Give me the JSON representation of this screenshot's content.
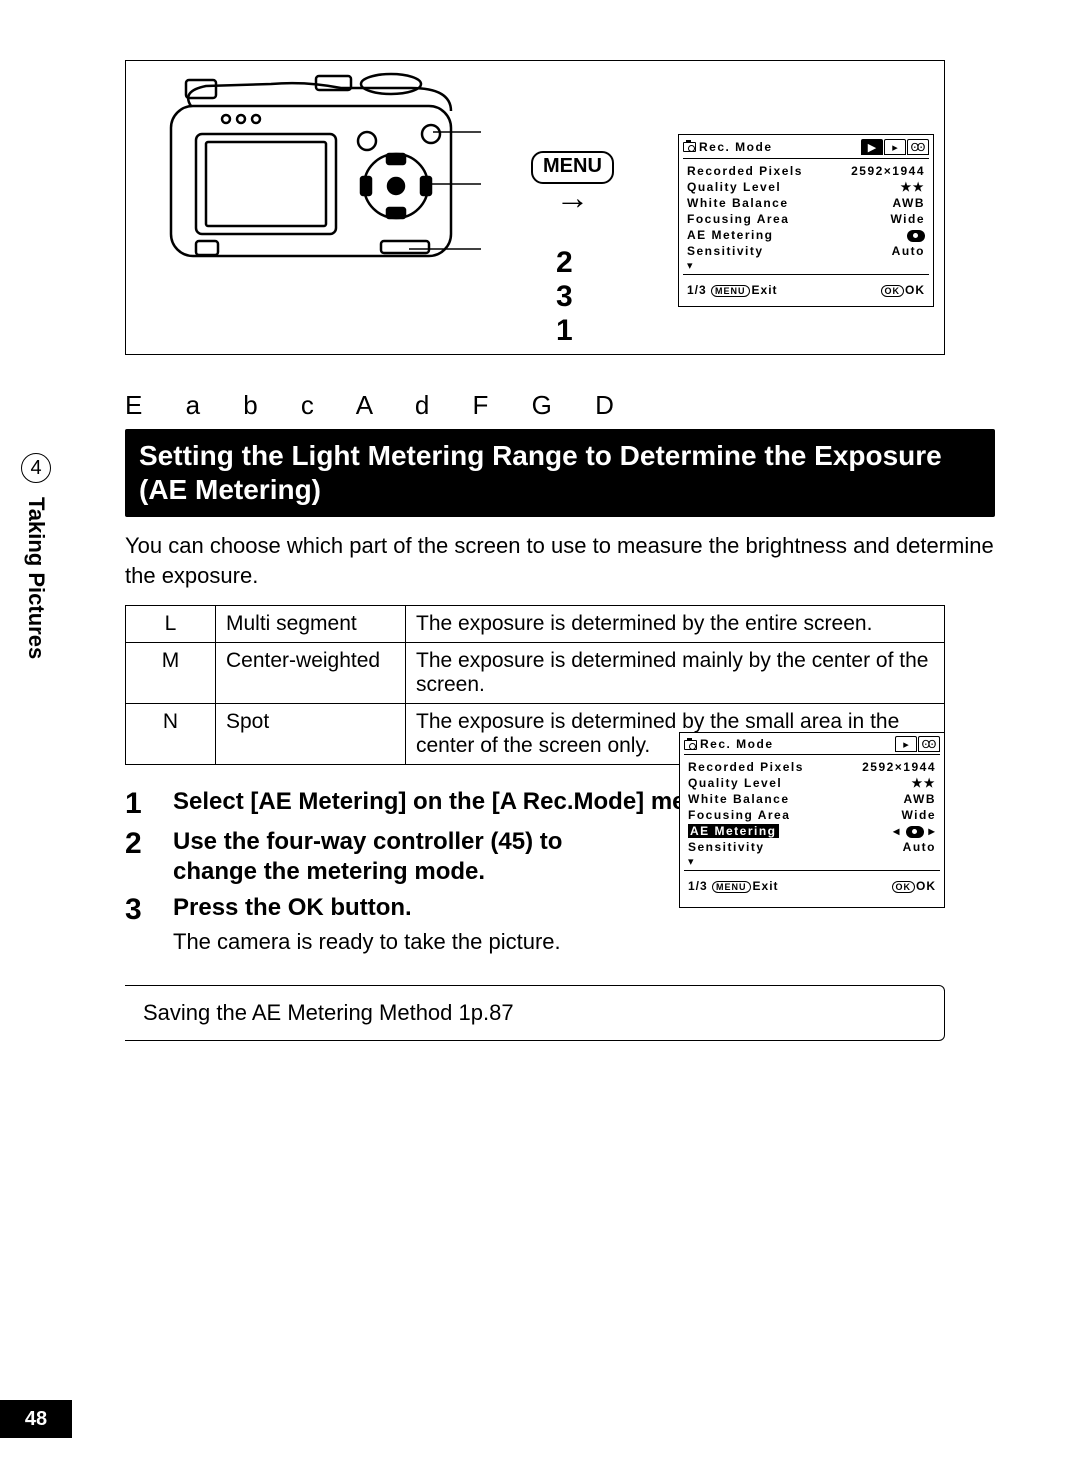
{
  "sidebar": {
    "chapter": "4",
    "label": "Taking Pictures"
  },
  "page_number": "48",
  "diagram": {
    "menu_label": "MENU",
    "step_labels": [
      "2",
      "3",
      "1"
    ]
  },
  "lcd1": {
    "title": "Rec. Mode",
    "rows": [
      {
        "label": "Recorded Pixels",
        "value": "2592×1944"
      },
      {
        "label": "Quality Level",
        "value": "★★"
      },
      {
        "label": "White Balance",
        "value": "AWB"
      },
      {
        "label": "Focusing Area",
        "value": "Wide"
      },
      {
        "label": "AE Metering",
        "value": "meter-icon"
      },
      {
        "label": "Sensitivity",
        "value": "Auto"
      }
    ],
    "footer_left": "1/3",
    "footer_menu": "MENU",
    "footer_exit": "Exit",
    "footer_ok": "OK",
    "footer_ok2": "OK"
  },
  "mode_icons": "E    a  b   c   A  d     F    G  D",
  "title": "Setting the Light Metering Range to Determine the Exposure (AE Metering)",
  "intro": "You can choose which part of the screen to use to measure the brightness and determine the exposure.",
  "table": [
    {
      "icon": "L",
      "name": "Multi segment",
      "desc": "The exposure is determined by the entire screen."
    },
    {
      "icon": "M",
      "name": "Center-weighted",
      "desc": "The exposure is determined mainly by the center of the screen."
    },
    {
      "icon": "N",
      "name": "Spot",
      "desc": "The exposure is determined by the small area in the center of the screen only."
    }
  ],
  "steps": [
    {
      "n": "1",
      "head": "Select [AE Metering] on the [A Rec.Mode] menu."
    },
    {
      "n": "2",
      "head": "Use the four-way controller (45) to change the metering mode."
    },
    {
      "n": "3",
      "head": "Press the OK button.",
      "sub": "The camera is ready to take the picture."
    }
  ],
  "lcd2": {
    "title": "Rec. Mode",
    "rows": [
      {
        "label": "Recorded Pixels",
        "value": "2592×1944"
      },
      {
        "label": "Quality Level",
        "value": "★★"
      },
      {
        "label": "White Balance",
        "value": "AWB"
      },
      {
        "label": "Focusing Area",
        "value": "Wide"
      },
      {
        "label": "AE Metering",
        "value": "meter-icon",
        "hl": true
      },
      {
        "label": "Sensitivity",
        "value": "Auto"
      }
    ],
    "footer_left": "1/3",
    "footer_menu": "MENU",
    "footer_exit": "Exit",
    "footer_ok": "OK",
    "footer_ok2": "OK"
  },
  "reference": "Saving the AE Metering Method 1p.87"
}
